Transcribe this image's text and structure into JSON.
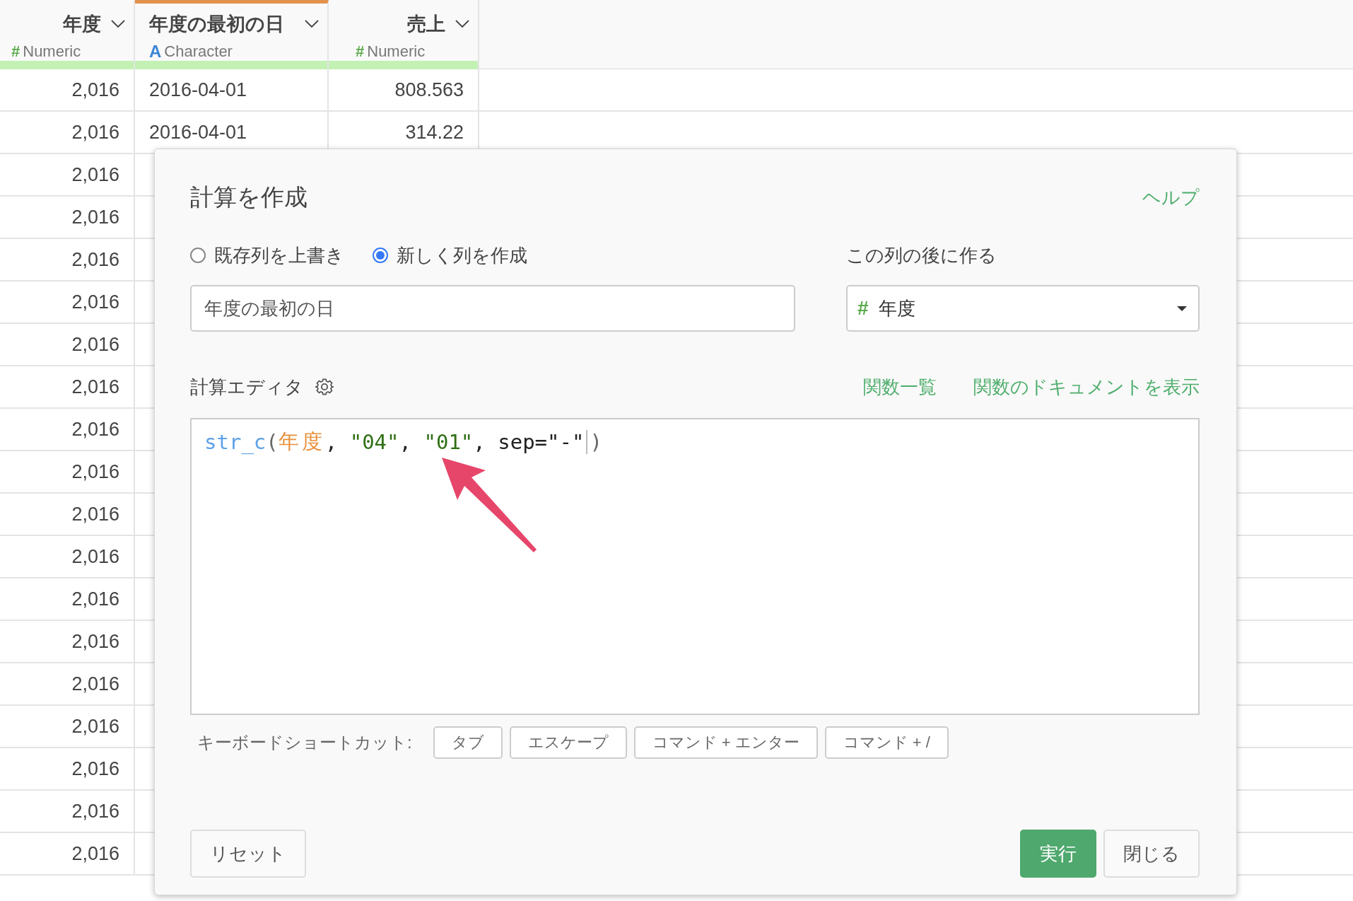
{
  "table": {
    "columns": [
      {
        "name": "年度",
        "type_icon": "#",
        "type_label": "Numeric",
        "kind": "numeric",
        "selected": false
      },
      {
        "name": "年度の最初の日",
        "type_icon": "A",
        "type_label": "Character",
        "kind": "character",
        "selected": true
      },
      {
        "name": "売上",
        "type_icon": "#",
        "type_label": "Numeric",
        "kind": "numeric",
        "selected": false
      }
    ],
    "rows": [
      [
        "2,016",
        "2016-04-01",
        "808.563"
      ],
      [
        "2,016",
        "2016-04-01",
        "314.22"
      ],
      [
        "2,016"
      ],
      [
        "2,016"
      ],
      [
        "2,016"
      ],
      [
        "2,016"
      ],
      [
        "2,016"
      ],
      [
        "2,016"
      ],
      [
        "2,016"
      ],
      [
        "2,016"
      ],
      [
        "2,016"
      ],
      [
        "2,016"
      ],
      [
        "2,016"
      ],
      [
        "2,016"
      ],
      [
        "2,016"
      ],
      [
        "2,016"
      ],
      [
        "2,016"
      ],
      [
        "2,016"
      ],
      [
        "2,016"
      ]
    ]
  },
  "dialog": {
    "title": "計算を作成",
    "help_link": "ヘルプ",
    "modes": [
      {
        "label": "既存列を上書き",
        "selected": false
      },
      {
        "label": "新しく列を作成",
        "selected": true
      }
    ],
    "column_name": {
      "value": "年度の最初の日"
    },
    "insert_after": {
      "label": "この列の後に作る",
      "value": "年度",
      "type_icon": "#",
      "kind": "numeric"
    },
    "editor": {
      "label": "計算エディタ",
      "links": [
        "関数一覧",
        "関数のドキュメントを表示"
      ],
      "code": [
        {
          "text": "str_c",
          "kind": "function"
        },
        {
          "text": "(",
          "kind": "paren"
        },
        {
          "text": "年度",
          "kind": "column"
        },
        {
          "text": ", ",
          "kind": "plain"
        },
        {
          "text": "\"04\"",
          "kind": "string"
        },
        {
          "text": ", ",
          "kind": "plain"
        },
        {
          "text": "\"01\"",
          "kind": "string"
        },
        {
          "text": ", sep=\"-\"",
          "kind": "plain",
          "cursor": true
        },
        {
          "text": ")",
          "kind": "paren"
        }
      ]
    },
    "shortcuts": {
      "label": "キーボードショートカット:",
      "keys": [
        "タブ",
        "エスケープ",
        "コマンド + エンター",
        "コマンド + /"
      ]
    },
    "buttons": {
      "reset": "リセット",
      "run": "実行",
      "close": "閉じる"
    }
  }
}
